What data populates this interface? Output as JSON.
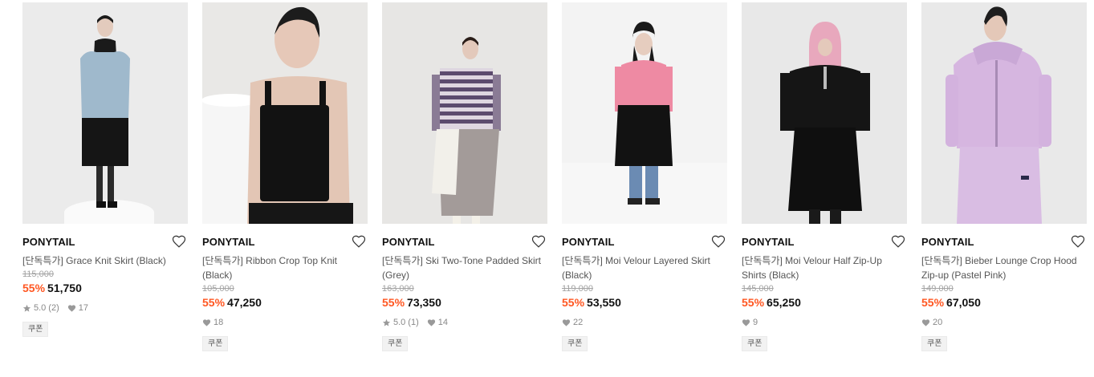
{
  "products": [
    {
      "brand": "PONYTAIL",
      "name": "[단독특가] Grace Knit Skirt (Black)",
      "original_price": "115,000",
      "discount": "55%",
      "price": "51,750",
      "rating": "5.0",
      "review_count": "(2)",
      "likes": "17",
      "coupon": "쿠폰",
      "image_label": "model in blue knit cardigan and black knit skirt"
    },
    {
      "brand": "PONYTAIL",
      "name": "[단독특가] Ribbon Crop Top Knit (Black)",
      "original_price": "105,000",
      "discount": "55%",
      "price": "47,250",
      "likes": "18",
      "coupon": "쿠폰",
      "image_label": "model in black ribbon crop knit top"
    },
    {
      "brand": "PONYTAIL",
      "name": "[단독특가] Ski Two-Tone Padded Skirt (Grey)",
      "original_price": "163,000",
      "discount": "55%",
      "price": "73,350",
      "rating": "5.0",
      "review_count": "(1)",
      "likes": "14",
      "coupon": "쿠폰",
      "image_label": "model in striped top and grey padded skirt"
    },
    {
      "brand": "PONYTAIL",
      "name": "[단독특가] Moi Velour Layered Skirt (Black)",
      "original_price": "119,000",
      "discount": "55%",
      "price": "53,550",
      "likes": "22",
      "coupon": "쿠폰",
      "image_label": "model in pink cardigan and black velour layered skirt"
    },
    {
      "brand": "PONYTAIL",
      "name": "[단독특가] Moi Velour Half Zip-Up Shirts (Black)",
      "original_price": "145,000",
      "discount": "55%",
      "price": "65,250",
      "likes": "9",
      "coupon": "쿠폰",
      "image_label": "model in pink balaclava and black velour half zip-up"
    },
    {
      "brand": "PONYTAIL",
      "name": "[단독특가] Bieber Lounge Crop Hood Zip-up (Pastel Pink)",
      "original_price": "149,000",
      "discount": "55%",
      "price": "67,050",
      "likes": "20",
      "coupon": "쿠폰",
      "image_label": "model in pastel pink lounge crop hood zip-up"
    }
  ],
  "colors": {
    "discount": "#ff5722",
    "strike": "#a3a3a3",
    "muted": "#888888"
  },
  "icons": {
    "wishlist": "heart-outline-icon",
    "rating": "star-icon",
    "likes": "heart-filled-icon"
  }
}
